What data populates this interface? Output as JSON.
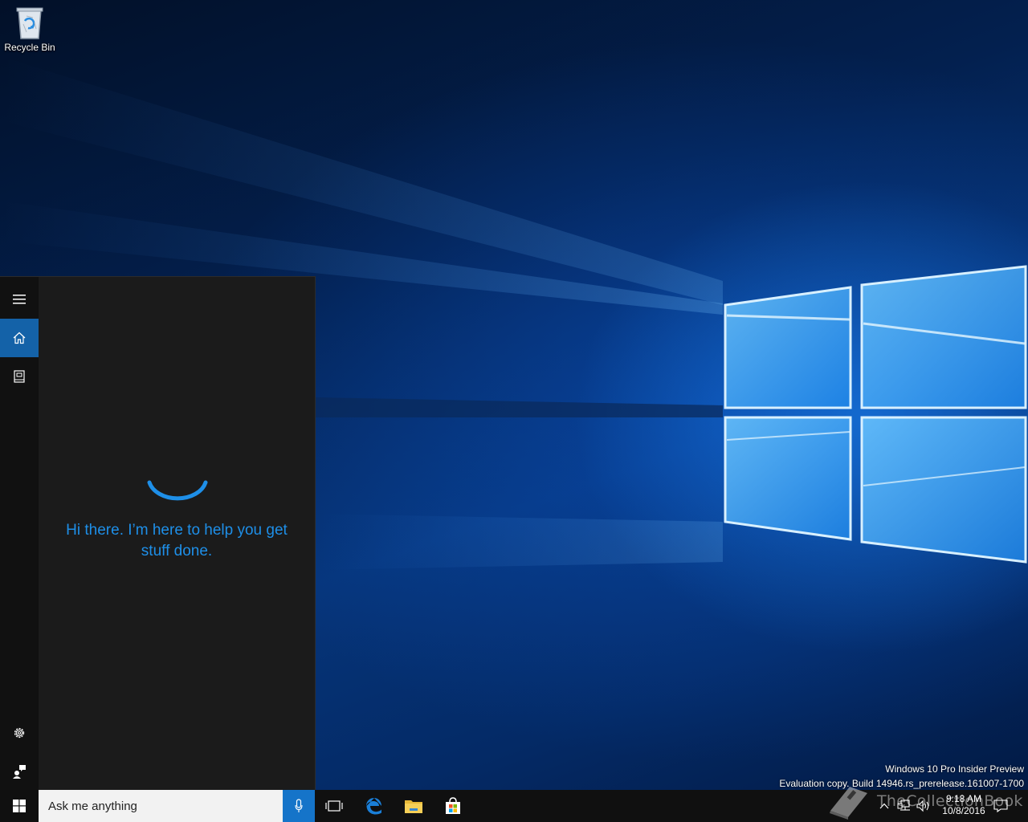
{
  "desktop": {
    "recycle_bin_label": "Recycle Bin"
  },
  "cortana": {
    "greeting": "Hi there. I’m here to help you get stuff done.",
    "rail": {
      "menu_icon": "hamburger-icon",
      "home_icon": "home-icon",
      "notebook_icon": "notebook-icon",
      "settings_icon": "gear-icon",
      "feedback_icon": "feedback-icon"
    },
    "accent_color": "#1e8fe8"
  },
  "watermark": {
    "line1": "Windows 10 Pro Insider Preview",
    "line2": "Evaluation copy. Build 14946.rs_prerelease.161007-1700"
  },
  "taskbar": {
    "search_placeholder": "Ask me anything",
    "pinned": [
      "task-view-icon",
      "edge-icon",
      "file-explorer-icon",
      "store-icon"
    ],
    "clock_time": "9:18 AM",
    "clock_date": "10/8/2016",
    "overlay_text": "TheCollectionBook"
  }
}
